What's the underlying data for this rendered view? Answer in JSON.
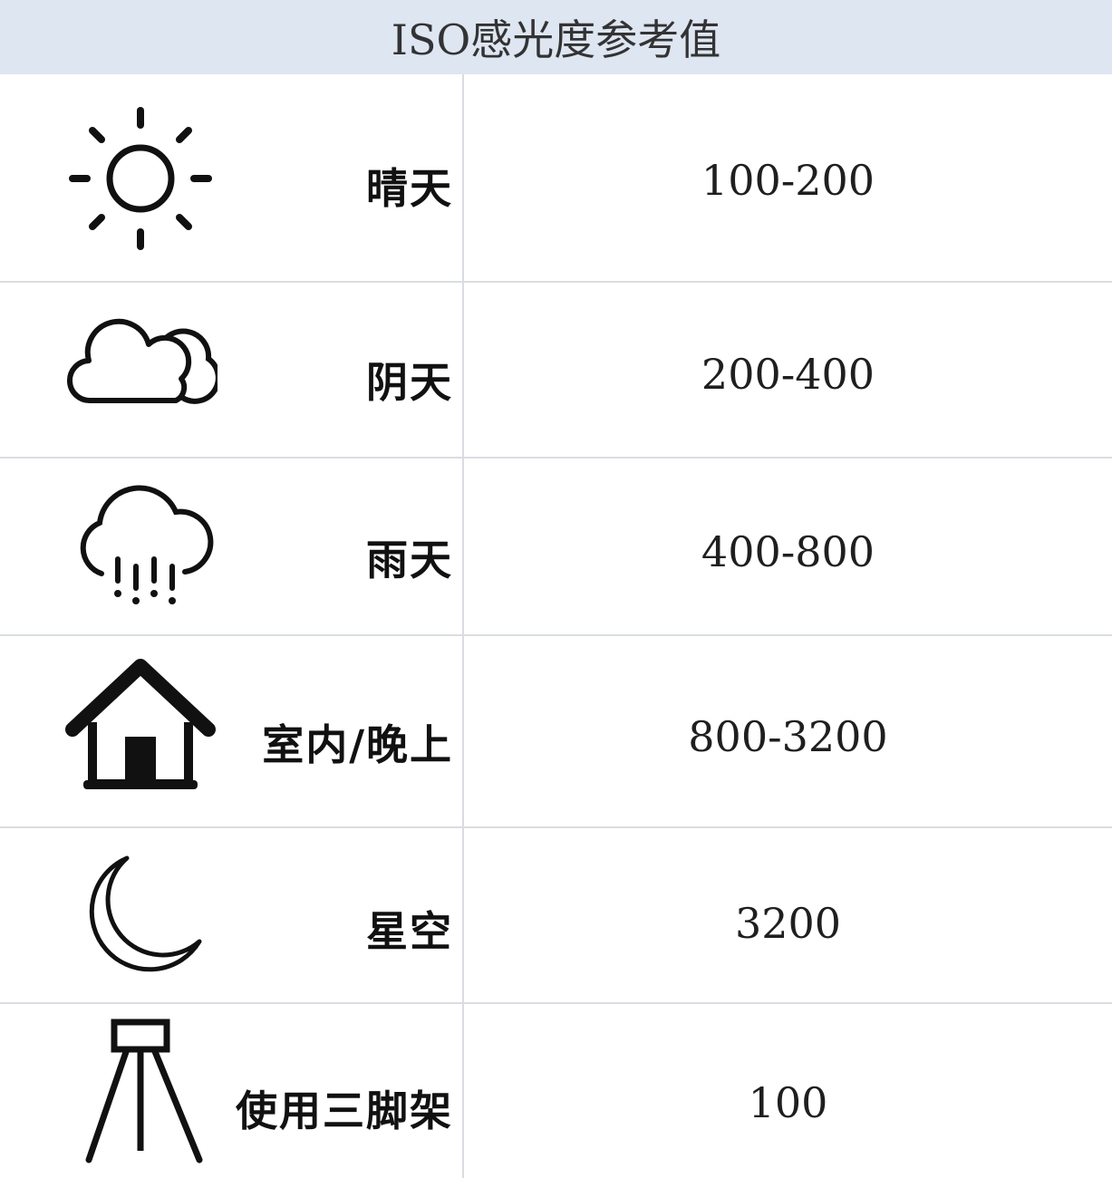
{
  "title": "ISO感光度参考值",
  "rows": [
    {
      "icon": "sun-icon",
      "label": "晴天",
      "value": "100-200"
    },
    {
      "icon": "cloud-icon",
      "label": "阴天",
      "value": "200-400"
    },
    {
      "icon": "rain-cloud-icon",
      "label": "雨天",
      "value": "400-800"
    },
    {
      "icon": "house-icon",
      "label": "室内/晚上",
      "value": "800-3200"
    },
    {
      "icon": "moon-icon",
      "label": "星空",
      "value": "3200"
    },
    {
      "icon": "tripod-icon",
      "label": "使用三脚架",
      "value": "100"
    }
  ]
}
